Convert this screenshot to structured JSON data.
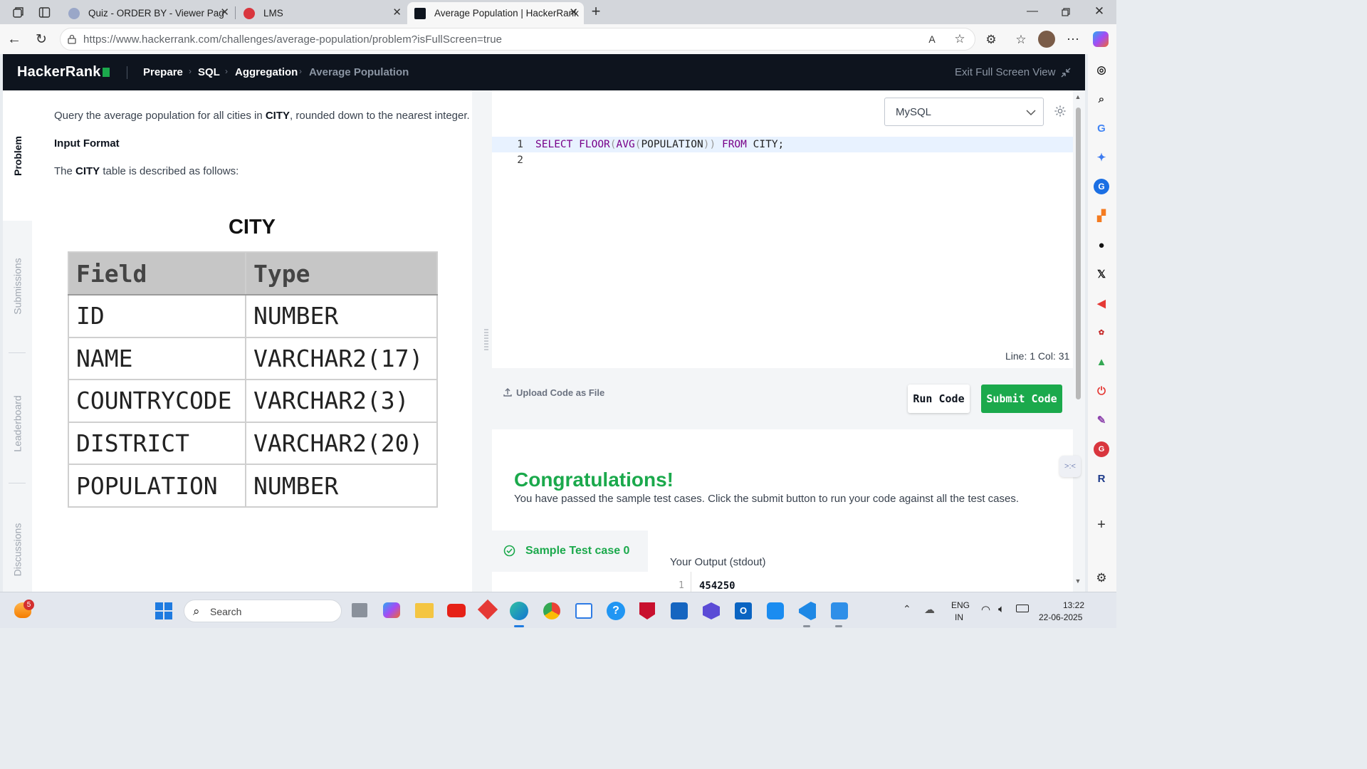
{
  "browser": {
    "tabs": [
      {
        "title": "Quiz - ORDER BY - Viewer Page |",
        "active": false
      },
      {
        "title": "LMS",
        "active": false
      },
      {
        "title": "Average Population | HackerRank",
        "active": true
      }
    ],
    "url": "https://www.hackerrank.com/challenges/average-population/problem?isFullScreen=true"
  },
  "header": {
    "logo": "HackerRank",
    "breadcrumbs": [
      "Prepare",
      "SQL",
      "Aggregation",
      "Average Population"
    ],
    "exit_fullscreen": "Exit Full Screen View"
  },
  "left_tabs": [
    "Problem",
    "Submissions",
    "Leaderboard",
    "Discussions"
  ],
  "problem": {
    "intro_before": "Query the average population for all cities in ",
    "intro_bold": "CITY",
    "intro_after": ", rounded down to the nearest integer.",
    "input_format_heading": "Input Format",
    "table_desc_before": "The ",
    "table_desc_bold": "CITY",
    "table_desc_after": " table is described as follows:",
    "table_title": "CITY",
    "table_headers": [
      "Field",
      "Type"
    ],
    "table_rows": [
      [
        "ID",
        "NUMBER"
      ],
      [
        "NAME",
        "VARCHAR2(17)"
      ],
      [
        "COUNTRYCODE",
        "VARCHAR2(3)"
      ],
      [
        "DISTRICT",
        "VARCHAR2(20)"
      ],
      [
        "POPULATION",
        "NUMBER"
      ]
    ]
  },
  "editor": {
    "language": "MySQL",
    "lines": [
      "1",
      "2"
    ],
    "code_tokens": {
      "t1": "SELECT",
      "t2": "FLOOR",
      "t3": "(",
      "t4": "AVG",
      "t5": "(",
      "t6": "POPULATION",
      "t7": "))",
      "t8": "FROM",
      "t9": "CITY;"
    },
    "status": "Line: 1 Col: 31",
    "upload_label": "Upload Code as File",
    "run_label": "Run Code",
    "submit_label": "Submit Code"
  },
  "result": {
    "title": "Congratulations!",
    "message": "You have passed the sample test cases. Click the submit button to run your code against all the test cases.",
    "testcase": "Sample Test case 0",
    "output_label": "Your Output (stdout)",
    "output_line": "1",
    "output_value": "454250"
  },
  "taskbar": {
    "search_placeholder": "Search",
    "notification_count": "5",
    "lang_line1": "ENG",
    "lang_line2": "IN",
    "time": "13:22",
    "date": "22-06-2025"
  },
  "colors": {
    "hr_dark": "#0e141e",
    "hr_green": "#1ba94c",
    "taskbar_bg": "#e3e7ee"
  }
}
